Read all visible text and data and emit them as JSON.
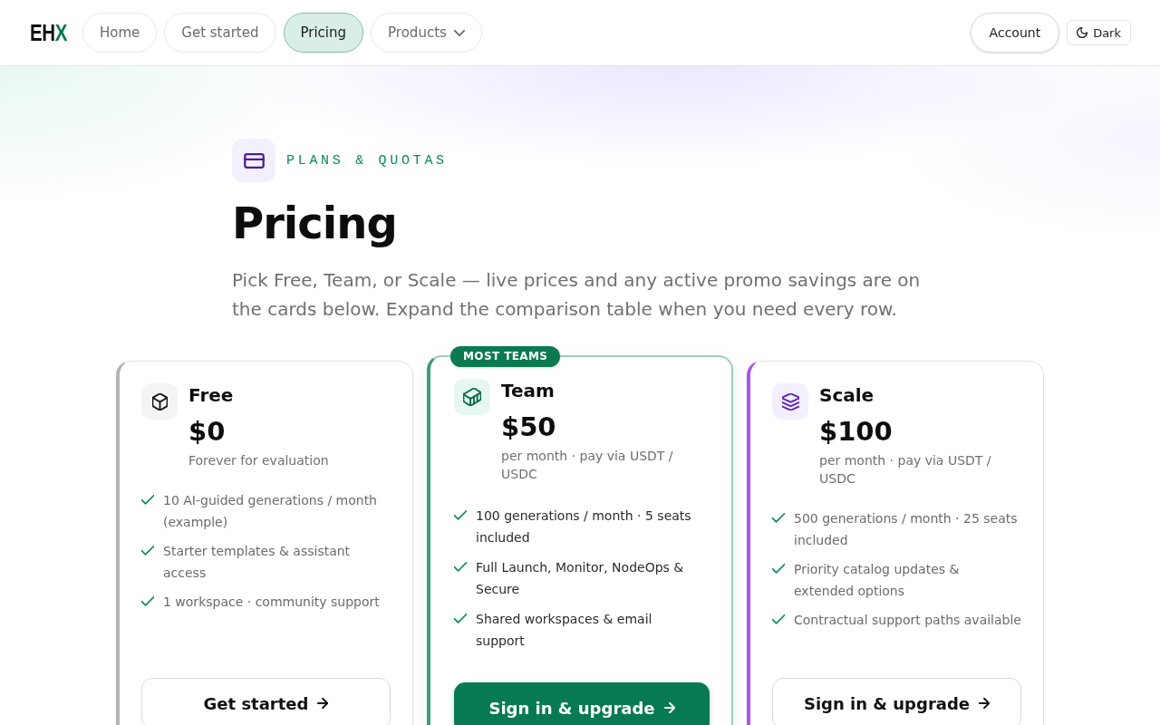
{
  "header": {
    "logo": [
      {
        "text": "EH",
        "accent": false
      },
      {
        "text": "X",
        "accent": true
      }
    ],
    "nav": [
      {
        "label": "Home",
        "kind": "link",
        "selected": false
      },
      {
        "label": "Get started",
        "kind": "link",
        "selected": false
      },
      {
        "label": "Pricing",
        "kind": "link",
        "selected": true
      },
      {
        "label": "Products",
        "kind": "dropdown",
        "selected": false
      }
    ],
    "account_button": "Account",
    "theme_toggle": "Dark"
  },
  "hero": {
    "eyebrow": "PLANS & QUOTAS",
    "title": "Pricing",
    "subtitle": "Pick Free, Team, or Scale — live prices and any active promo savings are on the cards below. Expand the comparison table when you need every row."
  },
  "plans": [
    {
      "name": "Free",
      "price": "$0",
      "note": "Forever for evaluation",
      "color": "#b4b4b4",
      "featured": false,
      "features": [
        "10 AI-guided generations / month (example)",
        "Starter templates & assistant access",
        "1 workspace · community support"
      ],
      "button": "Get started"
    },
    {
      "badge": "MOST TEAMS",
      "name": "Team",
      "price": "$50",
      "note": "per month · pay via USDT / USDC",
      "color": "#3f9b78",
      "featured": true,
      "features": [
        "100 generations / month · 5 seats included",
        "Full Launch, Monitor, NodeOps & Secure",
        "Shared workspaces & email support"
      ],
      "button": "Sign in & upgrade"
    },
    {
      "name": "Scale",
      "price": "$100",
      "note": "per month · pay via USDT / USDC",
      "color": "#a855f7",
      "featured": false,
      "features": [
        "500 generations / month · 25 seats included",
        "Priority catalog updates & extended options",
        "Contractual support paths available"
      ],
      "button": "Sign in & upgrade"
    }
  ]
}
